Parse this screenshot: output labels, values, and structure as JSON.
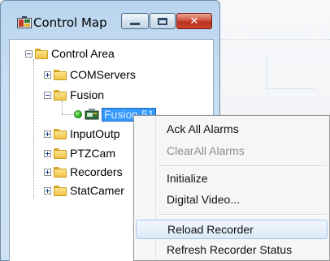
{
  "window": {
    "title": "Control Map",
    "controls": {
      "minimize_icon": "minimize-icon",
      "maximize_icon": "maximize-icon",
      "close_icon": "close-icon"
    }
  },
  "tree": {
    "root": {
      "label": "Control Area",
      "expanded": true
    },
    "children": [
      {
        "label": "COMServers",
        "expanded": false
      },
      {
        "label": "Fusion",
        "expanded": true,
        "children": [
          {
            "label": "Fusion 51",
            "selected": true,
            "status": "online"
          }
        ]
      },
      {
        "label": "InputOutp",
        "expanded": false
      },
      {
        "label": "PTZCam",
        "expanded": false
      },
      {
        "label": "Recorders",
        "expanded": false
      },
      {
        "label": "StatCamer",
        "expanded": false
      }
    ]
  },
  "context_menu": {
    "groups": [
      [
        {
          "label": "Ack All Alarms",
          "enabled": true
        },
        {
          "label": "ClearAll Alarms",
          "enabled": false
        }
      ],
      [
        {
          "label": "Initialize",
          "enabled": true
        },
        {
          "label": "Digital Video...",
          "enabled": true
        }
      ],
      [
        {
          "label": "Reload Recorder",
          "enabled": true,
          "hovered": true
        },
        {
          "label": "Refresh Recorder Status",
          "enabled": true
        }
      ]
    ]
  },
  "colors": {
    "selection": "#3399ff",
    "status_online": "#23a814",
    "close_button": "#c8462e"
  }
}
